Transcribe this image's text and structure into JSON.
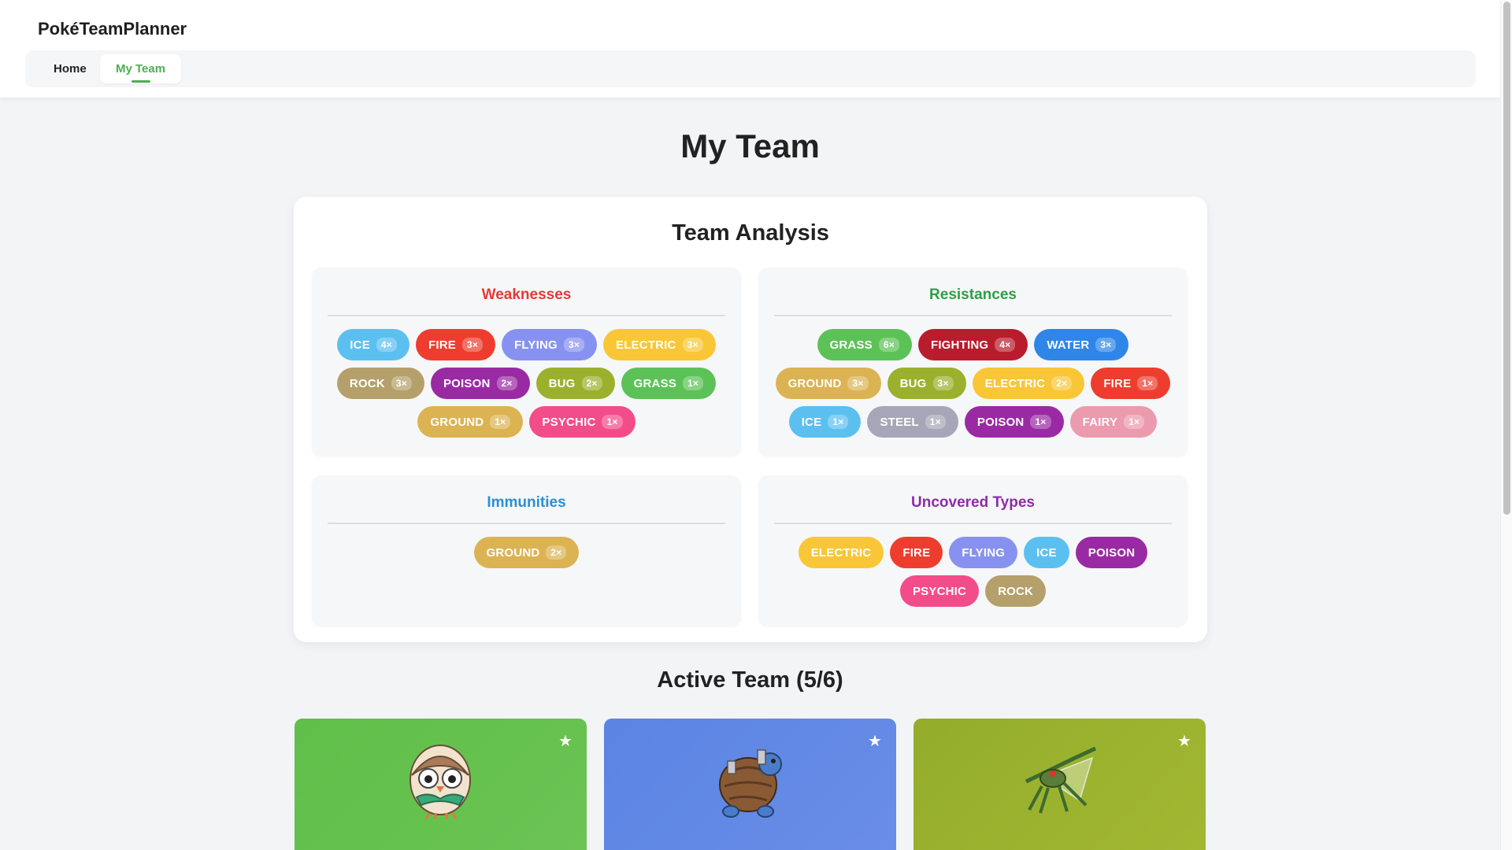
{
  "app": {
    "brand": "PokéTeamPlanner"
  },
  "nav": {
    "home": "Home",
    "my_team": "My Team"
  },
  "page": {
    "title": "My Team"
  },
  "analysis": {
    "title": "Team Analysis",
    "weaknesses": {
      "title": "Weaknesses",
      "color": "#e53935",
      "items": [
        {
          "type": "ICE",
          "mult": "4×",
          "color": "#5bc0f0"
        },
        {
          "type": "FIRE",
          "mult": "3×",
          "color": "#ee3d2e"
        },
        {
          "type": "FLYING",
          "mult": "3×",
          "color": "#8792f0"
        },
        {
          "type": "ELECTRIC",
          "mult": "3×",
          "color": "#f9c637"
        },
        {
          "type": "ROCK",
          "mult": "3×",
          "color": "#b5a06b"
        },
        {
          "type": "POISON",
          "mult": "2×",
          "color": "#9a2aa3"
        },
        {
          "type": "BUG",
          "mult": "2×",
          "color": "#9bb12d"
        },
        {
          "type": "GRASS",
          "mult": "1×",
          "color": "#5cc257"
        },
        {
          "type": "GROUND",
          "mult": "1×",
          "color": "#dcb353"
        },
        {
          "type": "PSYCHIC",
          "mult": "1×",
          "color": "#f34c8a"
        }
      ]
    },
    "resistances": {
      "title": "Resistances",
      "color": "#2ea043",
      "items": [
        {
          "type": "GRASS",
          "mult": "6×",
          "color": "#5cc257"
        },
        {
          "type": "FIGHTING",
          "mult": "4×",
          "color": "#b91c2c"
        },
        {
          "type": "WATER",
          "mult": "3×",
          "color": "#2f86e8"
        },
        {
          "type": "GROUND",
          "mult": "3×",
          "color": "#dcb353"
        },
        {
          "type": "BUG",
          "mult": "3×",
          "color": "#9bb12d"
        },
        {
          "type": "ELECTRIC",
          "mult": "2×",
          "color": "#f9c637"
        },
        {
          "type": "FIRE",
          "mult": "1×",
          "color": "#ee3d2e"
        },
        {
          "type": "ICE",
          "mult": "1×",
          "color": "#5bc0f0"
        },
        {
          "type": "STEEL",
          "mult": "1×",
          "color": "#a6a6b8"
        },
        {
          "type": "POISON",
          "mult": "1×",
          "color": "#9a2aa3"
        },
        {
          "type": "FAIRY",
          "mult": "1×",
          "color": "#ec9aae"
        }
      ]
    },
    "immunities": {
      "title": "Immunities",
      "color": "#2a8fd8",
      "items": [
        {
          "type": "GROUND",
          "mult": "2×",
          "color": "#dcb353"
        }
      ]
    },
    "uncovered": {
      "title": "Uncovered Types",
      "color": "#8e2ba8",
      "items": [
        {
          "type": "ELECTRIC",
          "color": "#f9c637"
        },
        {
          "type": "FIRE",
          "color": "#ee3d2e"
        },
        {
          "type": "FLYING",
          "color": "#8792f0"
        },
        {
          "type": "ICE",
          "color": "#5bc0f0"
        },
        {
          "type": "POISON",
          "color": "#9a2aa3"
        },
        {
          "type": "PSYCHIC",
          "color": "#f34c8a"
        },
        {
          "type": "ROCK",
          "color": "#b5a06b"
        }
      ]
    }
  },
  "team": {
    "title": "Active Team (5/6)",
    "cards": [
      {
        "icon": "rowlet-sprite",
        "star": "★"
      },
      {
        "icon": "blastoise-sprite",
        "star": "★"
      },
      {
        "icon": "bug-grass-pokemon-sprite",
        "star": "★"
      }
    ]
  }
}
